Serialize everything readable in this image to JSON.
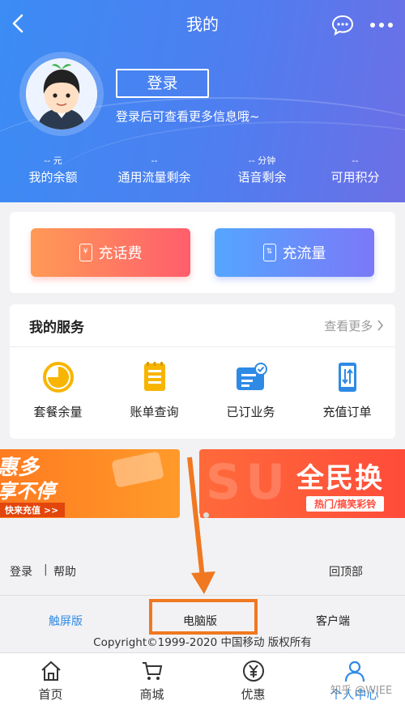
{
  "header": {
    "title": "我的",
    "login_label": "登录",
    "login_hint": "登录后可查看更多信息哦~",
    "stats": [
      {
        "value": "-- 元",
        "label": "我的余额"
      },
      {
        "value": "--",
        "label": "通用流量剩余"
      },
      {
        "value": "-- 分钟",
        "label": "语音剩余"
      },
      {
        "value": "--",
        "label": "可用积分"
      }
    ]
  },
  "recharge": {
    "phone_label": "充话费",
    "data_label": "充流量",
    "phone_icon_glyph": "¥",
    "data_icon_glyph": "⇅"
  },
  "services": {
    "title": "我的服务",
    "more": "查看更多",
    "items": [
      {
        "label": "套餐余量",
        "icon": "pie-chart-icon"
      },
      {
        "label": "账单查询",
        "icon": "bill-icon"
      },
      {
        "label": "已订业务",
        "icon": "subscription-icon"
      },
      {
        "label": "充值订单",
        "icon": "phone-order-icon"
      }
    ]
  },
  "banners": {
    "left_big_1": "惠多",
    "left_big_2": "享不停",
    "left_tag": "快来充值 >>",
    "right_big": "全民换",
    "right_tag": "热门/搞笑彩铃"
  },
  "footer": {
    "login": "登录",
    "separator": "|",
    "help": "帮助",
    "back_top": "回顶部",
    "versions": [
      "触屏版",
      "电脑版",
      "客户端"
    ],
    "copyright": "Copyright©1999-2020 中国移动 版权所有"
  },
  "tabbar": {
    "items": [
      {
        "label": "首页",
        "icon": "home-icon"
      },
      {
        "label": "商城",
        "icon": "cart-icon"
      },
      {
        "label": "优惠",
        "icon": "discount-icon"
      },
      {
        "label": "个人中心",
        "icon": "user-icon"
      }
    ],
    "active_index": 3
  },
  "watermark": "知乎 @WIEE",
  "colors": {
    "header_start": "#3b8cf4",
    "header_end": "#6d6fe6",
    "accent_blue": "#2f8ae5",
    "annotation_orange": "#f07820",
    "service_yellow": "#f7b500"
  }
}
